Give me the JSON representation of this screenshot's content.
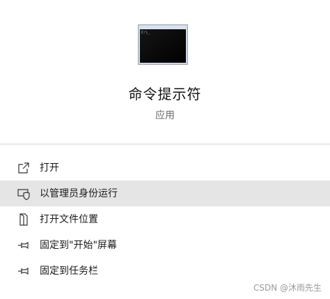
{
  "app": {
    "title": "命令提示符",
    "type": "应用",
    "icon": "command-prompt-icon"
  },
  "menu": {
    "items": [
      {
        "label": "打开",
        "icon": "open-icon",
        "highlighted": false
      },
      {
        "label": "以管理员身份运行",
        "icon": "admin-shield-icon",
        "highlighted": true
      },
      {
        "label": "打开文件位置",
        "icon": "file-location-icon",
        "highlighted": false
      },
      {
        "label": "固定到\"开始\"屏幕",
        "icon": "pin-icon",
        "highlighted": false
      },
      {
        "label": "固定到任务栏",
        "icon": "pin-icon",
        "highlighted": false
      }
    ]
  },
  "watermark": "CSDN @沐雨先生",
  "colors": {
    "hover_bg": "#e5e5e5",
    "text": "#1a1a1a",
    "secondary_text": "#6b6b6b"
  }
}
